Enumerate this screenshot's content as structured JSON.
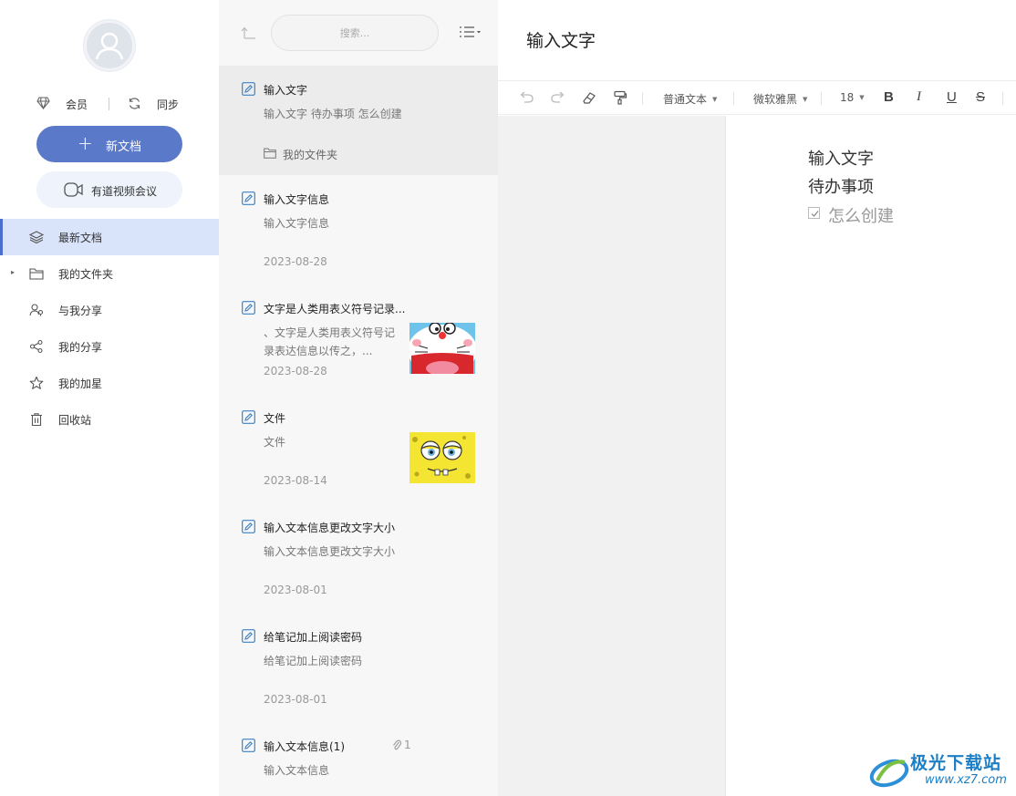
{
  "sidebar": {
    "member_label": "会员",
    "sync_label": "同步",
    "new_doc_label": "新文档",
    "video_meeting_label": "有道视频会议",
    "nav": [
      {
        "label": "最新文档",
        "icon": "layers-icon",
        "active": true
      },
      {
        "label": "我的文件夹",
        "icon": "folder-icon",
        "has_caret": true
      },
      {
        "label": "与我分享",
        "icon": "users-icon"
      },
      {
        "label": "我的分享",
        "icon": "share-icon"
      },
      {
        "label": "我的加星",
        "icon": "star-icon"
      },
      {
        "label": "回收站",
        "icon": "trash-icon"
      }
    ]
  },
  "list": {
    "search_placeholder": "搜索...",
    "docs": [
      {
        "title": "输入文字",
        "snippet": "输入文字 待办事项 怎么创建",
        "folder": "我的文件夹",
        "active": true
      },
      {
        "title": "输入文字信息",
        "snippet": "输入文字信息",
        "date": "2023-08-28"
      },
      {
        "title": "文字是人类用表义符号记录...",
        "snippet": "、文字是人类用表义符号记录表达信息以传之，...",
        "date": "2023-08-28",
        "thumb": "cartoon-cat"
      },
      {
        "title": "文件",
        "snippet": "文件",
        "date": "2023-08-14",
        "thumb": "cartoon-sponge"
      },
      {
        "title": "输入文本信息更改文字大小",
        "snippet": "输入文本信息更改文字大小",
        "date": "2023-08-01"
      },
      {
        "title": "给笔记加上阅读密码",
        "snippet": "给笔记加上阅读密码",
        "date": "2023-08-01"
      },
      {
        "title": "输入文本信息(1)",
        "snippet": "输入文本信息",
        "attachments": "1"
      }
    ]
  },
  "editor": {
    "title": "输入文字",
    "toolbar": {
      "paragraph_style": "普通文本",
      "font": "微软雅黑",
      "font_size": "18",
      "bold": "B",
      "italic": "I",
      "underline": "U",
      "strike": "S"
    },
    "content": {
      "line1": "输入文字",
      "line2": "待办事项",
      "todo": {
        "label": "怎么创建",
        "checked": true
      }
    }
  },
  "watermark": {
    "name": "极光下载站",
    "url": "www.xz7.com"
  }
}
